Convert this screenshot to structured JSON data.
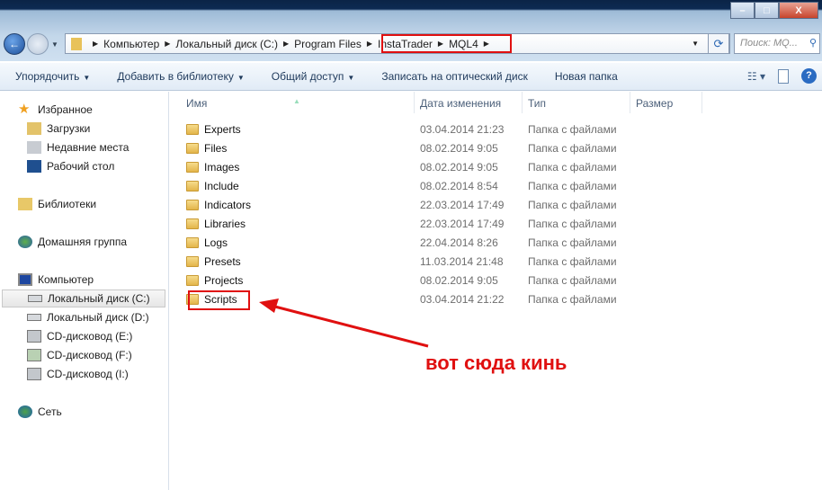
{
  "window": {
    "minimize": "–",
    "maximize": "□",
    "close": "X"
  },
  "address": {
    "crumbs": [
      "Компьютер",
      "Локальный диск (C:)",
      "Program Files",
      "InstaTrader",
      "MQL4"
    ],
    "search_placeholder": "Поиск: MQ..."
  },
  "toolbar": {
    "organize": "Упорядочить",
    "add_library": "Добавить в библиотеку",
    "share": "Общий доступ",
    "burn": "Записать на оптический диск",
    "new_folder": "Новая папка",
    "help": "?"
  },
  "sidebar": {
    "favorites": "Избранное",
    "downloads": "Загрузки",
    "recent": "Недавние места",
    "desktop": "Рабочий стол",
    "libraries": "Библиотеки",
    "homegroup": "Домашняя группа",
    "computer": "Компьютер",
    "disk_c": "Локальный диск (C:)",
    "disk_d": "Локальный диск (D:)",
    "cd_e": "CD-дисковод (E:)",
    "cd_f": "CD-дисковод (F:)",
    "cd_i": "CD-дисковод (I:)",
    "network": "Сеть"
  },
  "columns": {
    "name": "Имя",
    "date": "Дата изменения",
    "type": "Тип",
    "size": "Размер"
  },
  "files": [
    {
      "name": "Experts",
      "date": "03.04.2014 21:23",
      "type": "Папка с файлами"
    },
    {
      "name": "Files",
      "date": "08.02.2014 9:05",
      "type": "Папка с файлами"
    },
    {
      "name": "Images",
      "date": "08.02.2014 9:05",
      "type": "Папка с файлами"
    },
    {
      "name": "Include",
      "date": "08.02.2014 8:54",
      "type": "Папка с файлами"
    },
    {
      "name": "Indicators",
      "date": "22.03.2014 17:49",
      "type": "Папка с файлами"
    },
    {
      "name": "Libraries",
      "date": "22.03.2014 17:49",
      "type": "Папка с файлами"
    },
    {
      "name": "Logs",
      "date": "22.04.2014 8:26",
      "type": "Папка с файлами"
    },
    {
      "name": "Presets",
      "date": "11.03.2014 21:48",
      "type": "Папка с файлами"
    },
    {
      "name": "Projects",
      "date": "08.02.2014 9:05",
      "type": "Папка с файлами"
    },
    {
      "name": "Scripts",
      "date": "03.04.2014 21:22",
      "type": "Папка с файлами"
    }
  ],
  "annotation": {
    "text": "вот сюда кинь",
    "color": "#e01010"
  }
}
